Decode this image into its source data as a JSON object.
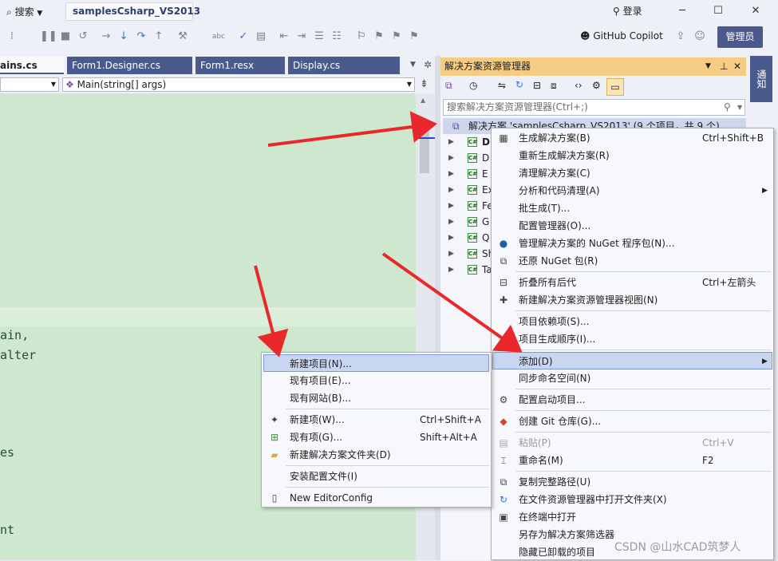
{
  "titlebar": {
    "search_label": "搜索",
    "project_tab": "samplesCsharp_VS2013",
    "login_label": "登录",
    "minimize": "─",
    "maximize": "☐",
    "close": "✕"
  },
  "toolbar": {
    "github_copilot": "GitHub Copilot",
    "admin_button": "管理员"
  },
  "editor_tabs": [
    {
      "label": "ains.cs",
      "active": true
    },
    {
      "label": "Form1.Designer.cs",
      "active": false
    },
    {
      "label": "Form1.resx",
      "active": false
    },
    {
      "label": "Display.cs",
      "active": false
    }
  ],
  "navbar": {
    "member_combo": "Main(string[] args)"
  },
  "editor_fragments": [
    "ain,",
    "alter",
    "es",
    "nt"
  ],
  "solution_explorer": {
    "title": "解决方案资源管理器",
    "search_placeholder": "搜索解决方案资源管理器(Ctrl+;)",
    "solution_node": "解决方案 'samplesCsharp_VS2013' (9 个项目，共 9 个)",
    "projects": [
      "D",
      "D",
      "E",
      "Ex",
      "Fe",
      "G",
      "Q",
      "Sh",
      "Ta"
    ]
  },
  "right_strip": {
    "vertical_tab": "通知"
  },
  "context_menu": {
    "items": [
      {
        "label": "生成解决方案(B)",
        "shortcut": "Ctrl+Shift+B",
        "icon": "build-icon"
      },
      {
        "label": "重新生成解决方案(R)",
        "shortcut": "",
        "icon": ""
      },
      {
        "label": "清理解决方案(C)",
        "shortcut": "",
        "icon": ""
      },
      {
        "label": "分析和代码清理(A)",
        "shortcut": "",
        "icon": "",
        "submenu": true
      },
      {
        "label": "批生成(T)...",
        "shortcut": "",
        "icon": ""
      },
      {
        "label": "配置管理器(O)...",
        "shortcut": "",
        "icon": ""
      },
      {
        "label": "管理解决方案的 NuGet 程序包(N)...",
        "shortcut": "",
        "icon": "nuget-icon"
      },
      {
        "label": "还原 NuGet 包(R)",
        "shortcut": "",
        "icon": "restore-icon"
      },
      {
        "label": "折叠所有后代",
        "shortcut": "Ctrl+左箭头",
        "icon": "collapse-icon"
      },
      {
        "label": "新建解决方案资源管理器视图(N)",
        "shortcut": "",
        "icon": "new-view-icon"
      },
      {
        "label": "项目依赖项(S)...",
        "shortcut": "",
        "icon": ""
      },
      {
        "label": "项目生成顺序(I)...",
        "shortcut": "",
        "icon": ""
      },
      {
        "label": "添加(D)",
        "shortcut": "",
        "icon": "",
        "submenu": true,
        "highlighted": true
      },
      {
        "label": "同步命名空间(N)",
        "shortcut": "",
        "icon": ""
      },
      {
        "label": "配置启动项目...",
        "shortcut": "",
        "icon": "gear-icon"
      },
      {
        "label": "创建 Git 仓库(G)...",
        "shortcut": "",
        "icon": "git-icon"
      },
      {
        "label": "粘贴(P)",
        "shortcut": "Ctrl+V",
        "icon": "paste-icon",
        "disabled": true
      },
      {
        "label": "重命名(M)",
        "shortcut": "F2",
        "icon": "rename-icon"
      },
      {
        "label": "复制完整路径(U)",
        "shortcut": "",
        "icon": "copy-icon"
      },
      {
        "label": "在文件资源管理器中打开文件夹(X)",
        "shortcut": "",
        "icon": "open-folder-icon"
      },
      {
        "label": "在终端中打开",
        "shortcut": "",
        "icon": "terminal-icon"
      },
      {
        "label": "另存为解决方案筛选器",
        "shortcut": "",
        "icon": ""
      },
      {
        "label": "隐藏已卸载的项目",
        "shortcut": "",
        "icon": ""
      }
    ]
  },
  "add_submenu": {
    "items": [
      {
        "label": "新建项目(N)...",
        "shortcut": "",
        "icon": "",
        "highlighted": true
      },
      {
        "label": "现有项目(E)...",
        "shortcut": "",
        "icon": ""
      },
      {
        "label": "现有网站(B)...",
        "shortcut": "",
        "icon": ""
      },
      {
        "label": "新建项(W)...",
        "shortcut": "Ctrl+Shift+A",
        "icon": "new-item-icon"
      },
      {
        "label": "现有项(G)...",
        "shortcut": "Shift+Alt+A",
        "icon": "existing-item-icon"
      },
      {
        "label": "新建解决方案文件夹(D)",
        "shortcut": "",
        "icon": "folder-icon"
      },
      {
        "label": "安装配置文件(I)",
        "shortcut": "",
        "icon": ""
      },
      {
        "label": "New EditorConfig",
        "shortcut": "",
        "icon": "editorconfig-icon"
      }
    ]
  },
  "watermark": "CSDN @山水CAD筑梦人",
  "colors": {
    "editor_bg": "#cde8cf",
    "tab_active": "#4b5a8c",
    "se_title": "#f5cc84",
    "highlight": "#c9d6f2",
    "arrow": "#e8282a"
  }
}
